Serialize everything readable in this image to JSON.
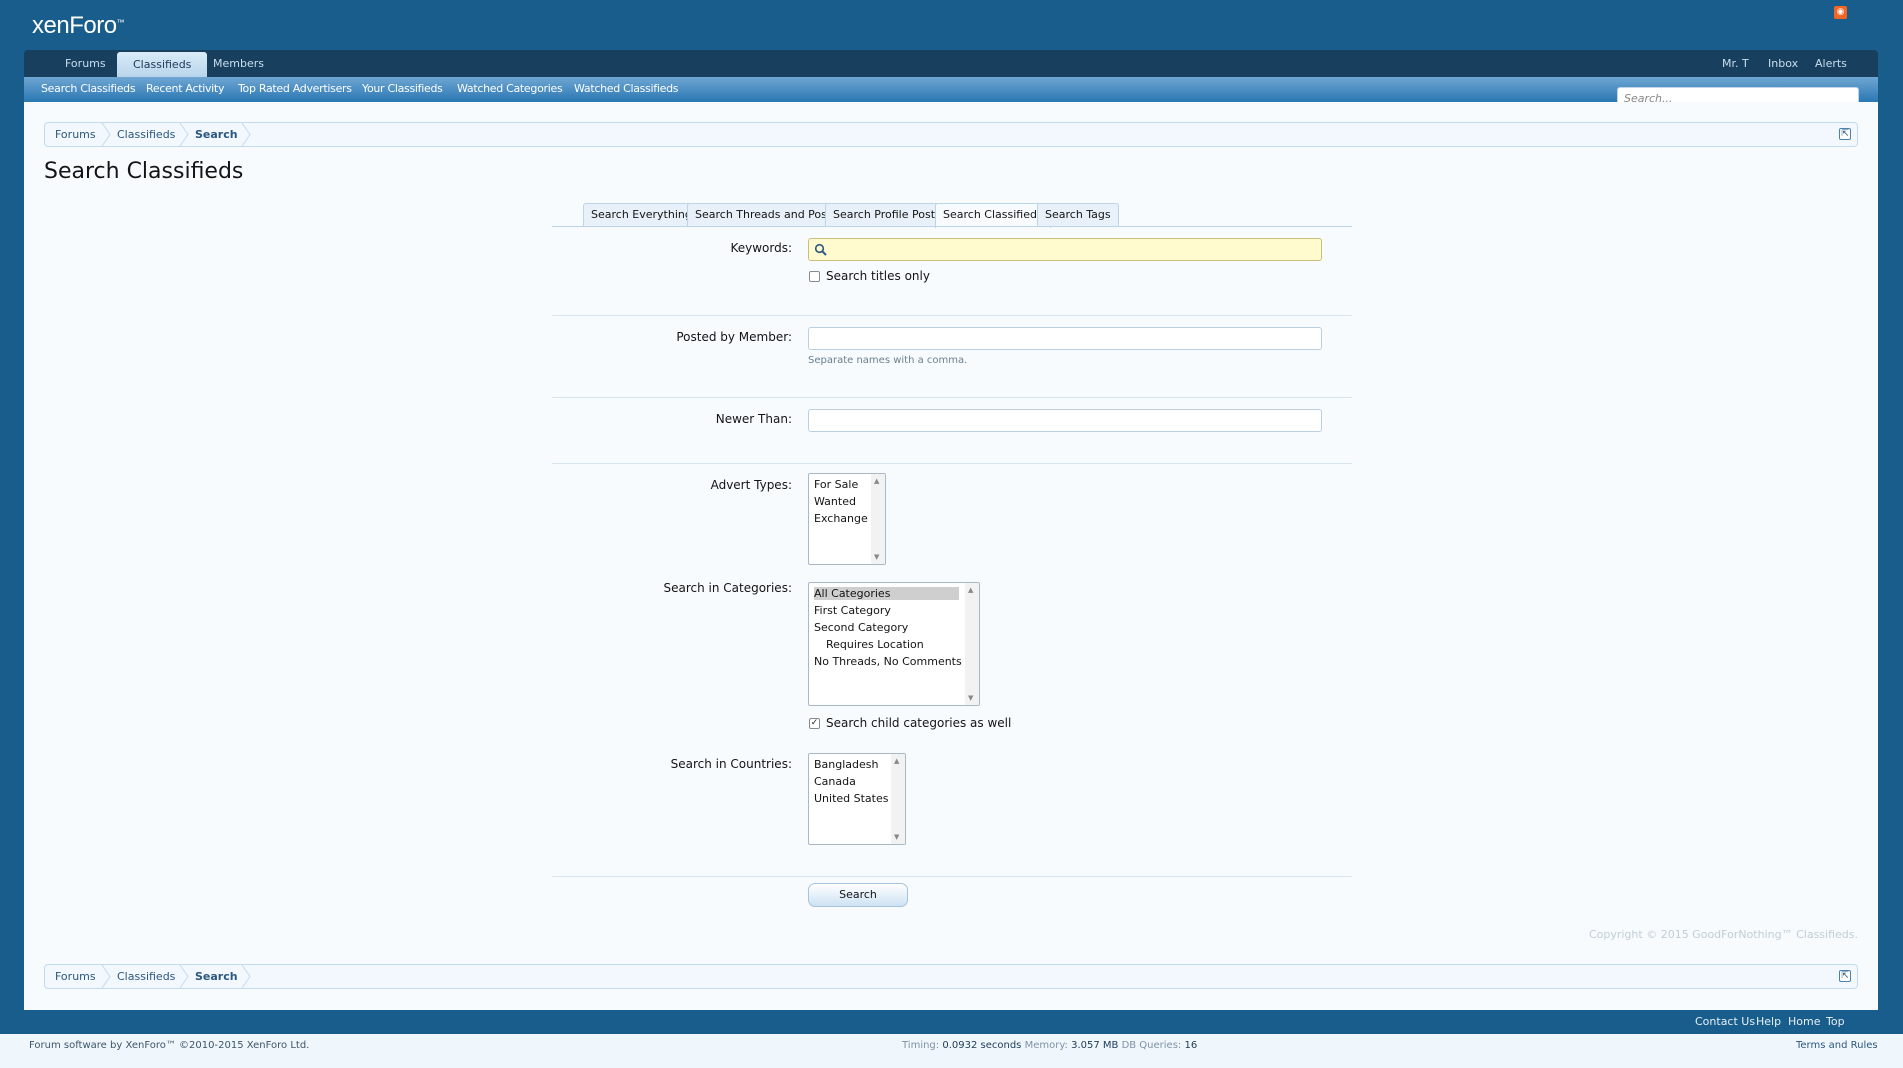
{
  "site": {
    "logo_text": "xenForo",
    "logo_mark": "™"
  },
  "nav": {
    "tabs": [
      "Forums",
      "Classifieds",
      "Members"
    ],
    "selected_tab": "Classifieds",
    "visitor": [
      "Mr. T",
      "Inbox",
      "Alerts"
    ]
  },
  "subnav": {
    "links": [
      "Search Classifieds",
      "Recent Activity",
      "Top Rated Advertisers",
      "Your Classifieds",
      "Watched Categories",
      "Watched Classifieds"
    ]
  },
  "quick_search": {
    "placeholder": "Search..."
  },
  "breadcrumb": {
    "items": [
      "Forums",
      "Classifieds",
      "Search"
    ]
  },
  "page": {
    "title": "Search Classifieds"
  },
  "search_tabs": {
    "items": [
      "Search Everything",
      "Search Threads and Posts",
      "Search Profile Posts",
      "Search Classifieds",
      "Search Tags"
    ],
    "active": "Search Classifieds"
  },
  "form": {
    "keywords_label": "Keywords:",
    "keywords_value": "",
    "titles_only_label": "Search titles only",
    "titles_only_checked": false,
    "member_label": "Posted by Member:",
    "member_value": "",
    "member_hint": "Separate names with a comma.",
    "newer_label": "Newer Than:",
    "newer_value": "",
    "advert_types_label": "Advert Types:",
    "advert_types": [
      "For Sale",
      "Wanted",
      "Exchange"
    ],
    "categories_label": "Search in Categories:",
    "categories": [
      "All Categories",
      "First Category",
      "Second Category",
      "Requires Location",
      "No Threads, No Comments"
    ],
    "categories_selected": "All Categories",
    "child_categories_label": "Search child categories as well",
    "child_categories_checked": true,
    "countries_label": "Search in Countries:",
    "countries": [
      "Bangladesh",
      "Canada",
      "United States"
    ],
    "submit_label": "Search"
  },
  "copyright": "Copyright © 2015 GoodForNothing™ Classifieds.",
  "footer": {
    "links": [
      "Contact Us",
      "Help",
      "Home",
      "Top"
    ],
    "legal": "Forum software by XenForo™ ©2010-2015 XenForo Ltd.",
    "debug": {
      "timing_label": "Timing:",
      "timing_value": "0.0932 seconds",
      "memory_label": "Memory:",
      "memory_value": "3.057 MB",
      "db_label": "DB Queries:",
      "db_value": "16"
    },
    "terms": "Terms and Rules"
  },
  "colors": {
    "header_bg": "#185d8b",
    "nav_dark": "#183f5d",
    "keywords_bg": "#fffbcf",
    "rss": "#f26522"
  }
}
